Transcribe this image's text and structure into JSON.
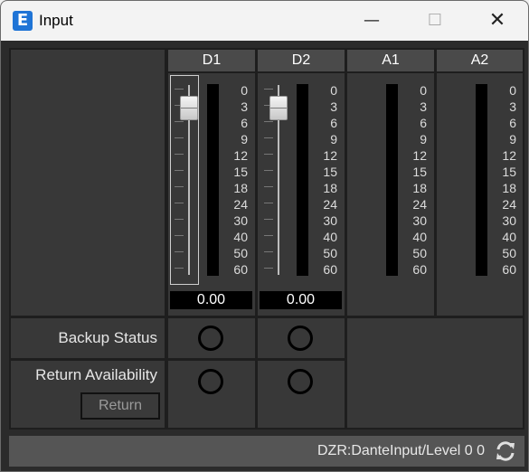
{
  "window": {
    "title": "Input",
    "icon_letter": "E"
  },
  "controls": {
    "minimize": "—",
    "maximize": "☐",
    "close": "✕"
  },
  "channels": [
    {
      "name": "D1",
      "has_fader": true,
      "value": "0.00"
    },
    {
      "name": "D2",
      "has_fader": true,
      "value": "0.00"
    },
    {
      "name": "A1",
      "has_fader": false
    },
    {
      "name": "A2",
      "has_fader": false
    }
  ],
  "meter_scale": [
    "0",
    "3",
    "6",
    "9",
    "12",
    "15",
    "18",
    "24",
    "30",
    "40",
    "50",
    "60"
  ],
  "rows": {
    "backup_status": "Backup Status",
    "return_availability": "Return Availability",
    "return_button": "Return"
  },
  "status": {
    "text": "DZR:DanteInput/Level 0 0"
  },
  "icons": {
    "app": "app-logo-icon",
    "refresh": "refresh-icon"
  }
}
